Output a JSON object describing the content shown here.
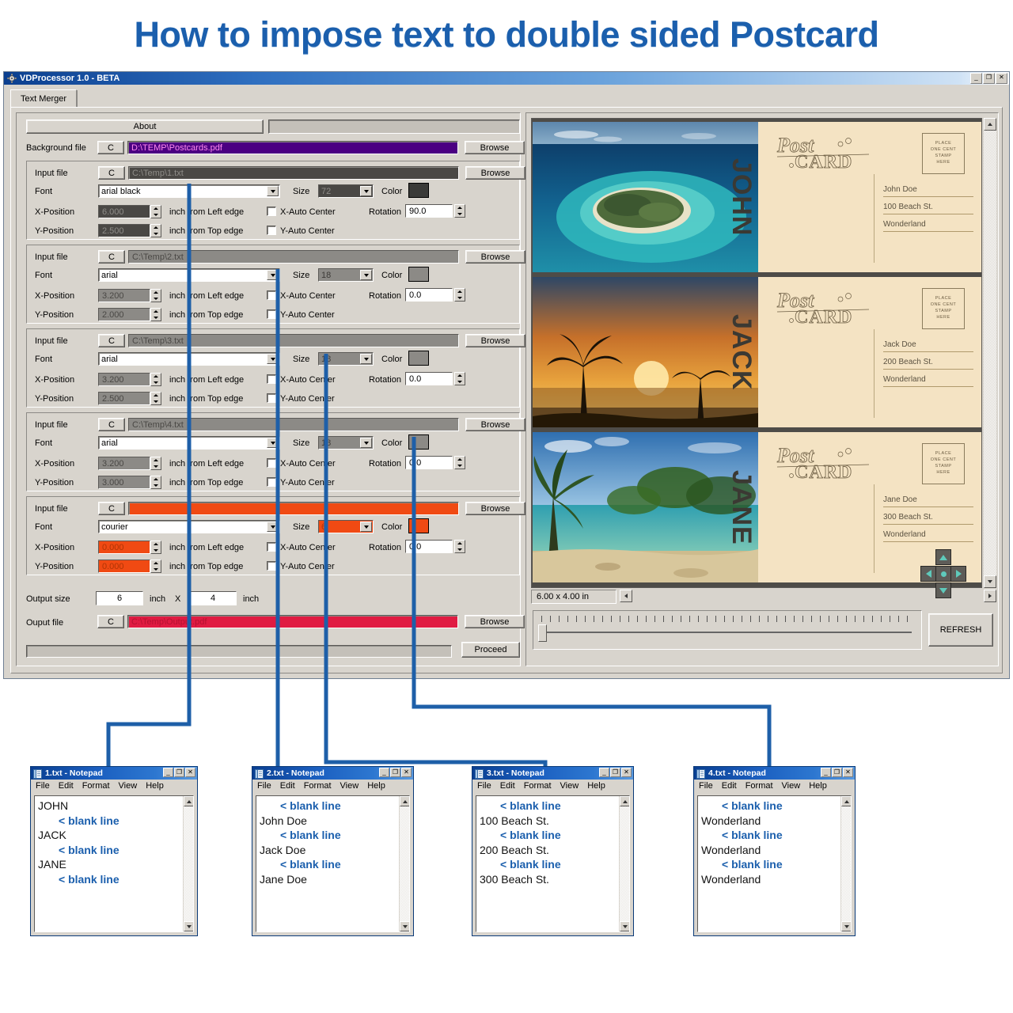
{
  "banner": {
    "title": "How to impose text to double sided Postcard"
  },
  "app": {
    "titlebar": {
      "title": "VDProcessor 1.0 - BETA",
      "icon": "gear-icon",
      "minimize": "_",
      "maximize": "❐",
      "close": "✕"
    },
    "tabs": [
      {
        "label": "Text Merger"
      }
    ],
    "about_button": "About",
    "background": {
      "label": "Background file",
      "c_button": "C",
      "path": "D:\\TEMP\\Postcards.pdf",
      "browse": "Browse",
      "field_color": "#4b0082",
      "text_color": "#ff8cf0"
    },
    "common": {
      "input_label": "Input file",
      "font_label": "Font",
      "size_label": "Size",
      "color_label": "Color",
      "xpos_label": "X-Position",
      "ypos_label": "Y-Position",
      "inch_from_left": "inch from Left edge",
      "inch_from_top": "inch from Top edge",
      "x_auto_center": "X-Auto Center",
      "y_auto_center": "Y-Auto Center",
      "rotation_label": "Rotation",
      "c_button": "C",
      "browse": "Browse"
    },
    "groups": [
      {
        "path": "C:\\Temp\\1.txt",
        "font": "arial black",
        "size": "72",
        "color": "#3a3a38",
        "x": "6.000",
        "y": "2.500",
        "rotation": "90.0",
        "field_bg": "#4a4845",
        "field_fg": "#8e8c88",
        "highlight": false
      },
      {
        "path": "C:\\Temp\\2.txt",
        "font": "arial",
        "size": "18",
        "color": "#8c8a86",
        "x": "3.200",
        "y": "2.000",
        "rotation": "0.0",
        "field_bg": "#8c8a86",
        "field_fg": "#4a4845",
        "highlight": false
      },
      {
        "path": "C:\\Temp\\3.txt",
        "font": "arial",
        "size": "18",
        "color": "#8c8a86",
        "x": "3.200",
        "y": "2.500",
        "rotation": "0.0",
        "field_bg": "#8c8a86",
        "field_fg": "#4a4845",
        "highlight": false
      },
      {
        "path": "C:\\Temp\\4.txt",
        "font": "arial",
        "size": "18",
        "color": "#8c8a86",
        "x": "3.200",
        "y": "3.000",
        "rotation": "0.0",
        "field_bg": "#8c8a86",
        "field_fg": "#4a4845",
        "highlight": false
      },
      {
        "path": "",
        "font": "courier",
        "size": "6",
        "color": "#f04a13",
        "x": "0.000",
        "y": "0.000",
        "rotation": "0.0",
        "field_bg": "#f04a13",
        "field_fg": "#b03505",
        "highlight": true
      }
    ],
    "output": {
      "size_label": "Output size",
      "width": "6",
      "height": "4",
      "inch": "inch",
      "x_sep": "X",
      "file_label": "Ouput file",
      "c_button": "C",
      "path": "C:\\Temp\\Output.pdf",
      "field_color": "#e01b42",
      "browse": "Browse",
      "proceed": "Proceed"
    }
  },
  "preview": {
    "size_readout": "6.00 x 4.00 in",
    "refresh_button": "REFRESH",
    "postcards": [
      {
        "vertical_name": "JOHN",
        "logo_top": "Post",
        "logo_bottom": "CARD",
        "stamp": [
          "PLACE",
          "ONE CENT",
          "STAMP",
          "HERE"
        ],
        "address": [
          "John Doe",
          "100 Beach St.",
          "Wonderland"
        ],
        "scene": "island"
      },
      {
        "vertical_name": "JACK",
        "logo_top": "Post",
        "logo_bottom": "CARD",
        "stamp": [
          "PLACE",
          "ONE CENT",
          "STAMP",
          "HERE"
        ],
        "address": [
          "Jack Doe",
          "200 Beach St.",
          "Wonderland"
        ],
        "scene": "sunset"
      },
      {
        "vertical_name": "JANE",
        "logo_top": "Post",
        "logo_bottom": "CARD",
        "stamp": [
          "PLACE",
          "ONE CENT",
          "STAMP",
          "HERE"
        ],
        "address": [
          "Jane Doe",
          "300 Beach St.",
          "Wonderland"
        ],
        "scene": "beach"
      }
    ],
    "dpad": [
      "up-arrow-icon",
      "left-arrow-icon",
      "center-icon",
      "right-arrow-icon",
      "down-arrow-icon"
    ]
  },
  "notepads": [
    {
      "title": "1.txt - Notepad",
      "menu": [
        "File",
        "Edit",
        "Format",
        "View",
        "Help"
      ],
      "lines": [
        {
          "text": "JOHN",
          "blank": false
        },
        {
          "text": "< blank line",
          "blank": true
        },
        {
          "text": "JACK",
          "blank": false
        },
        {
          "text": "< blank line",
          "blank": true
        },
        {
          "text": "JANE",
          "blank": false
        },
        {
          "text": "< blank line",
          "blank": true
        }
      ]
    },
    {
      "title": "2.txt - Notepad",
      "menu": [
        "File",
        "Edit",
        "Format",
        "View",
        "Help"
      ],
      "lines": [
        {
          "text": "< blank line",
          "blank": true
        },
        {
          "text": "John Doe",
          "blank": false
        },
        {
          "text": "< blank line",
          "blank": true
        },
        {
          "text": "Jack Doe",
          "blank": false
        },
        {
          "text": "< blank line",
          "blank": true
        },
        {
          "text": "Jane Doe",
          "blank": false
        }
      ]
    },
    {
      "title": "3.txt - Notepad",
      "menu": [
        "File",
        "Edit",
        "Format",
        "View",
        "Help"
      ],
      "lines": [
        {
          "text": "< blank line",
          "blank": true
        },
        {
          "text": "100 Beach St.",
          "blank": false
        },
        {
          "text": "< blank line",
          "blank": true
        },
        {
          "text": "200 Beach St.",
          "blank": false
        },
        {
          "text": "< blank line",
          "blank": true
        },
        {
          "text": "300 Beach St.",
          "blank": false
        }
      ]
    },
    {
      "title": "4.txt - Notepad",
      "menu": [
        "File",
        "Edit",
        "Format",
        "View",
        "Help"
      ],
      "lines": [
        {
          "text": "< blank line",
          "blank": true
        },
        {
          "text": "Wonderland",
          "blank": false
        },
        {
          "text": "< blank line",
          "blank": true
        },
        {
          "text": "Wonderland",
          "blank": false
        },
        {
          "text": "< blank line",
          "blank": true
        },
        {
          "text": "Wonderland",
          "blank": false
        }
      ]
    }
  ],
  "colors": {
    "accent_blue": "#1b5fad",
    "connector": "#1e5fa8",
    "window_face": "#d8d4cd",
    "postcard_paper": "#f4e3c3"
  }
}
